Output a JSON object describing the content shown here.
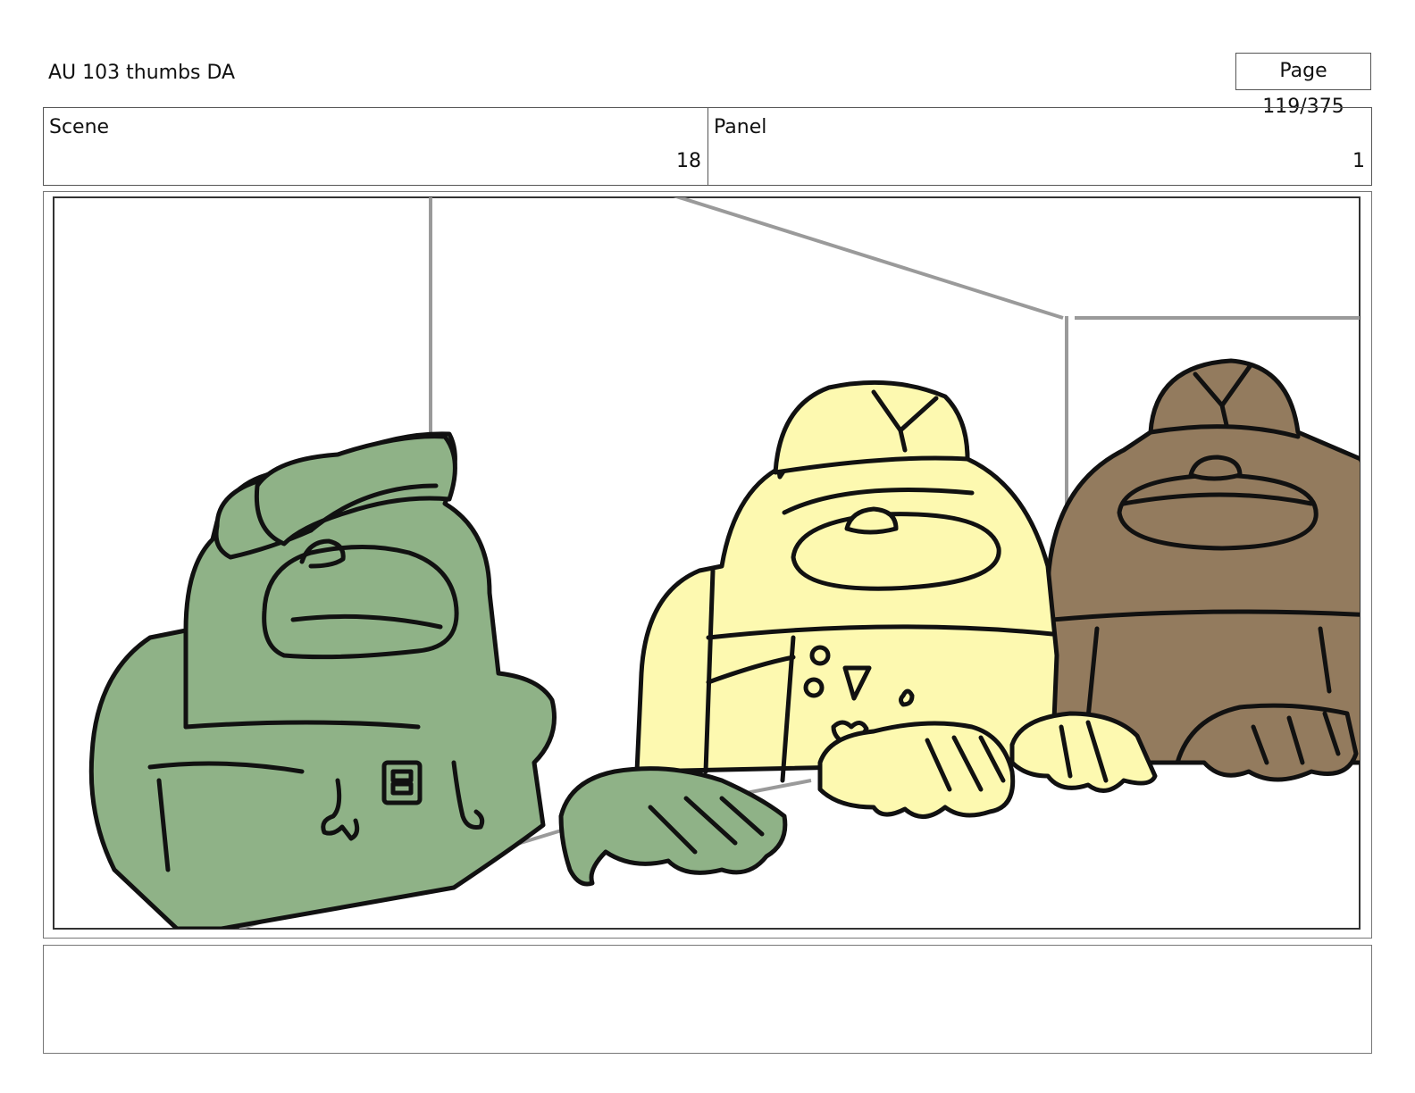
{
  "header": {
    "title": "AU 103 thumbs DA",
    "page_counter": "Page 119/375"
  },
  "info": {
    "scene_label": "Scene",
    "scene_value": "18",
    "panel_label": "Panel",
    "panel_value": "1"
  },
  "colors": {
    "green_character": "#8fb287",
    "yellow_character": "#fdf9b0",
    "brown_character": "#937b5e",
    "line": "#111111",
    "background_lines": "#9a9a9a"
  },
  "notes": {
    "text": ""
  }
}
